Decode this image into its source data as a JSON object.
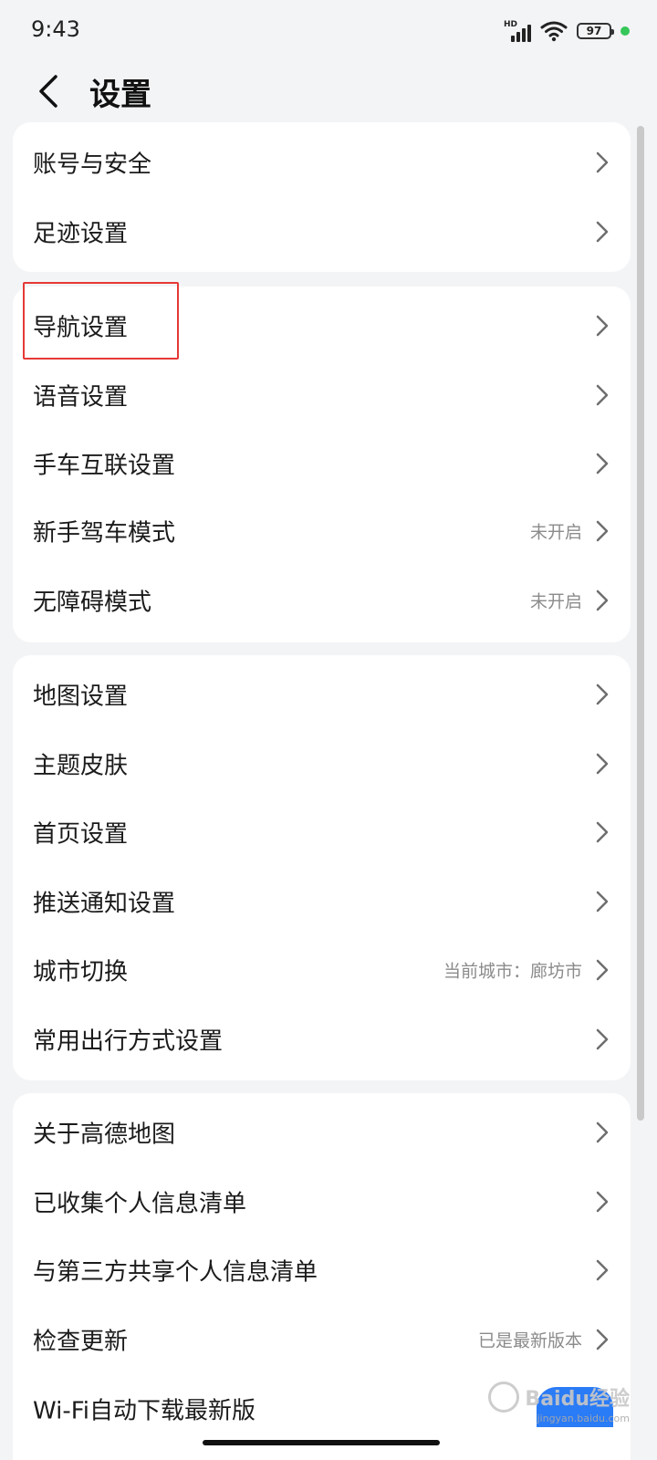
{
  "status_bar": {
    "time": "9:43",
    "network_label": "HD",
    "battery": "97",
    "icons": [
      "signal-icon",
      "wifi-icon",
      "battery-icon",
      "green-dot-icon"
    ]
  },
  "header": {
    "back_icon": "chevron-left-icon",
    "title": "设置"
  },
  "groups": [
    {
      "items": [
        {
          "label": "账号与安全",
          "value": ""
        },
        {
          "label": "足迹设置",
          "value": ""
        }
      ]
    },
    {
      "items": [
        {
          "label": "导航设置",
          "value": ""
        },
        {
          "label": "语音设置",
          "value": ""
        },
        {
          "label": "手车互联设置",
          "value": ""
        },
        {
          "label": "新手驾车模式",
          "value": "未开启"
        },
        {
          "label": "无障碍模式",
          "value": "未开启"
        }
      ]
    },
    {
      "items": [
        {
          "label": "地图设置",
          "value": ""
        },
        {
          "label": "主题皮肤",
          "value": ""
        },
        {
          "label": "首页设置",
          "value": ""
        },
        {
          "label": "推送通知设置",
          "value": ""
        },
        {
          "label": "城市切换",
          "value": "当前城市：廊坊市"
        },
        {
          "label": "常用出行方式设置",
          "value": ""
        }
      ]
    },
    {
      "items": [
        {
          "label": "关于高德地图",
          "value": ""
        },
        {
          "label": "已收集个人信息清单",
          "value": ""
        },
        {
          "label": "与第三方共享个人信息清单",
          "value": ""
        },
        {
          "label": "检查更新",
          "value": "已是最新版本"
        },
        {
          "label": "Wi-Fi自动下载最新版",
          "value": ""
        }
      ]
    }
  ],
  "watermark": {
    "text": "Baidu经验",
    "sub": "jingyan.baidu.com"
  },
  "colors": {
    "background": "#f3f4f6",
    "card": "#ffffff",
    "highlight": "#e53935",
    "secondary_text": "#8b8b8b"
  }
}
